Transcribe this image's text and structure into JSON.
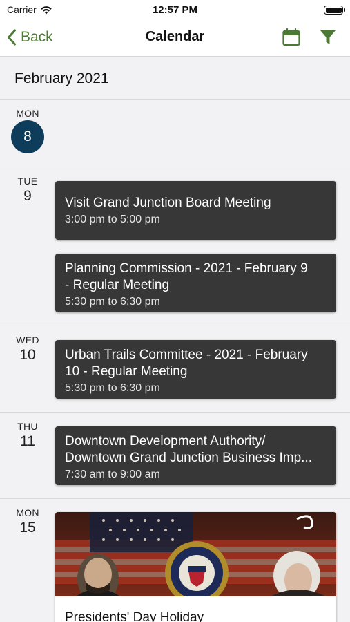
{
  "status": {
    "carrier": "Carrier",
    "time": "12:57 PM"
  },
  "nav": {
    "back_label": "Back",
    "title": "Calendar"
  },
  "colors": {
    "accent": "#4c7a34",
    "today": "#0e3d5c",
    "card": "#373737"
  },
  "month": "February 2021",
  "days": [
    {
      "dow": "MON",
      "num": "8"
    },
    {
      "dow": "TUE",
      "num": "9"
    },
    {
      "dow": "WED",
      "num": "10"
    },
    {
      "dow": "THU",
      "num": "11"
    },
    {
      "dow": "MON",
      "num": "15"
    }
  ],
  "events": [
    {
      "title": "Visit Grand Junction Board Meeting",
      "time": "3:00 pm to 5:00 pm"
    },
    {
      "title_l1": "Planning Commission - 2021 - February 9",
      "title_l2": "- Regular Meeting",
      "time": "5:30 pm to 6:30 pm"
    },
    {
      "title_l1": "Urban Trails Committee - 2021 - February",
      "title_l2": "10 - Regular Meeting",
      "time": "5:30 pm to 6:30 pm"
    },
    {
      "title_l1": "Downtown Development Authority/",
      "title_l2": "Downtown Grand Junction Business Imp...",
      "time": "7:30 am to 9:00 am"
    },
    {
      "title": "Presidents' Day Holiday"
    }
  ],
  "icons": {
    "back": "chevron-left-icon",
    "calendar": "calendar-icon",
    "filter": "filter-icon",
    "wifi": "wifi-icon",
    "battery": "battery-icon"
  }
}
